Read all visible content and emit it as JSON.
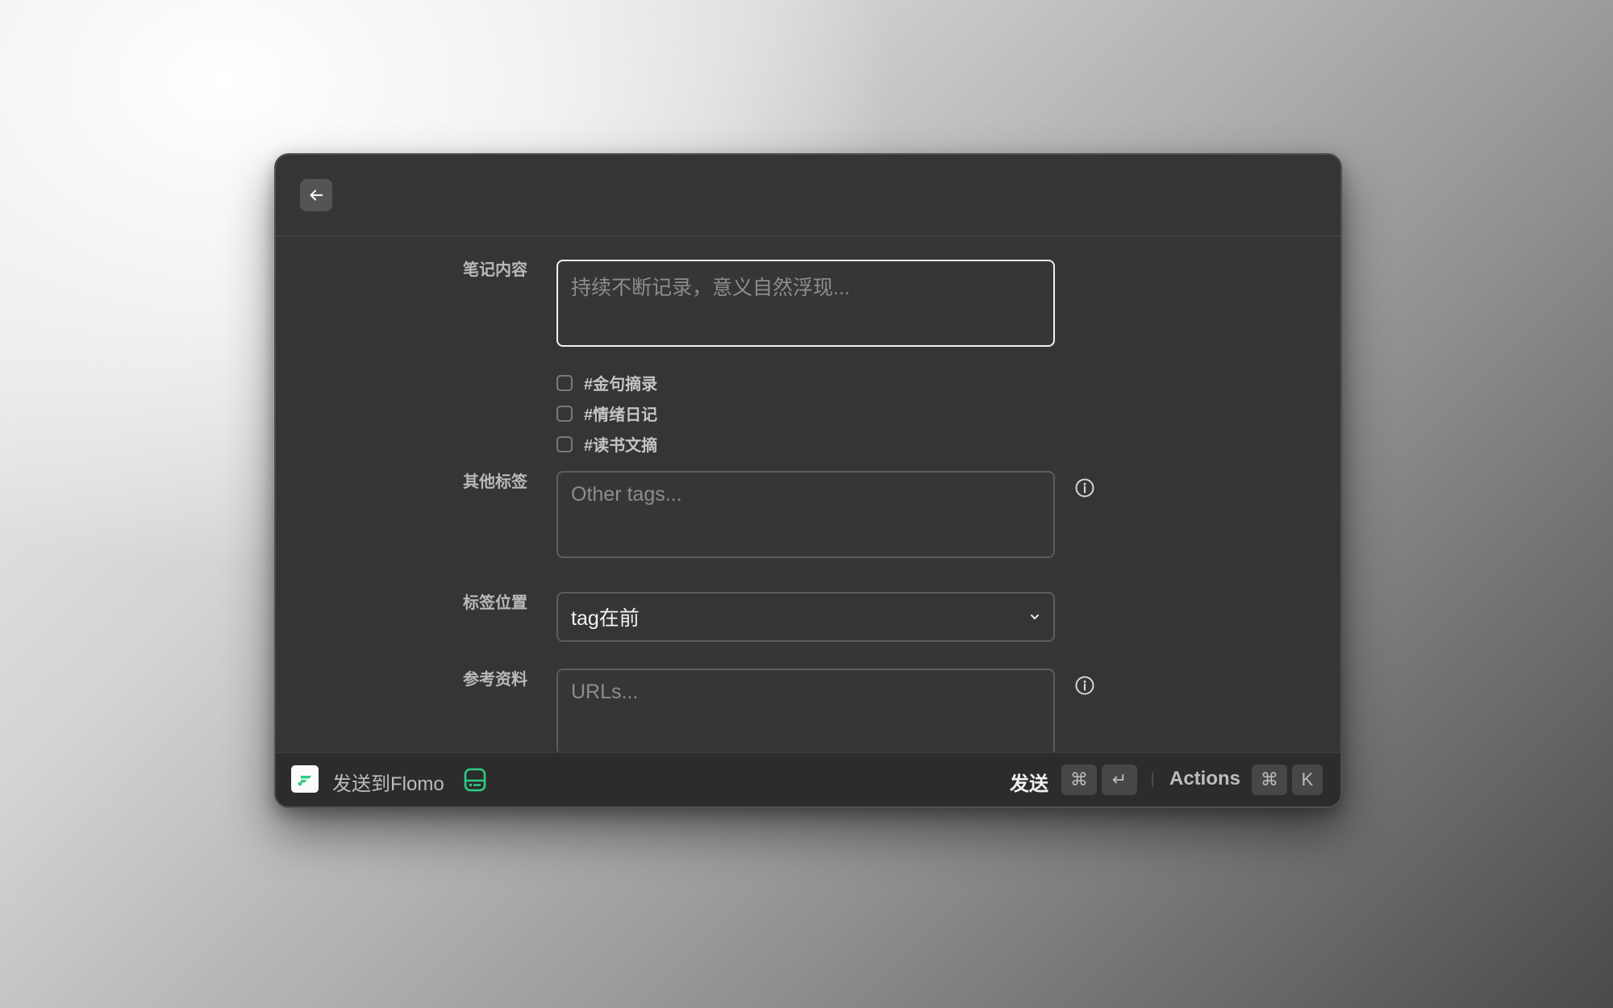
{
  "form": {
    "note": {
      "label": "笔记内容",
      "placeholder": "持续不断记录，意义自然浮现..."
    },
    "tag_options": [
      {
        "label": "#金句摘录",
        "checked": false
      },
      {
        "label": "#情绪日记",
        "checked": false
      },
      {
        "label": "#读书文摘",
        "checked": false
      }
    ],
    "other_tags": {
      "label": "其他标签",
      "placeholder": "Other tags..."
    },
    "tag_position": {
      "label": "标签位置",
      "value": "tag在前"
    },
    "references": {
      "label": "参考资料",
      "placeholder": "URLs..."
    }
  },
  "footer": {
    "app_name": "发送到Flomo",
    "primary_action": "发送",
    "primary_keys": [
      "⌘",
      "↵"
    ],
    "actions_label": "Actions",
    "actions_keys": [
      "⌘",
      "K"
    ]
  },
  "icons": {
    "back": "arrow-left-icon",
    "info": "info-circle-icon",
    "select": "chevron-down-icon",
    "app": "flomo-logo-icon",
    "inbox": "inbox-tray-icon"
  },
  "colors": {
    "window_bg": "#353535",
    "footer_bg": "#2c2c2c",
    "accent_green": "#2ecc86",
    "focus_border": "#f0f0f0"
  }
}
